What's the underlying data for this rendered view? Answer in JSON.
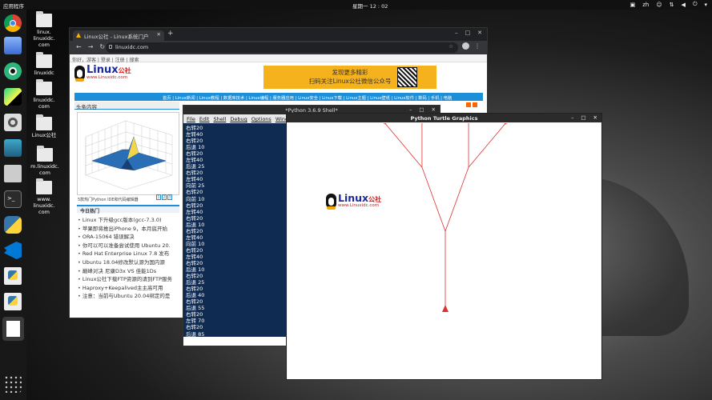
{
  "topbar": {
    "apps": "应用程序",
    "clock": "星期一 12 : 02",
    "lang": "zh"
  },
  "desktop_icons": [
    {
      "label": "linux.\nlinuxidc.\ncom"
    },
    {
      "label": "linuxidc"
    },
    {
      "label": "linuxidc.\ncom"
    },
    {
      "label": "Linux公社"
    },
    {
      "label": "m.linuxidc.\ncom"
    },
    {
      "label": "www.\nlinuxidc.\ncom"
    }
  ],
  "chrome": {
    "tab_title": "Linux公社 - Linux系统门户",
    "url": "linuxidc.com",
    "linkbar": "你好，游客  |  登录  |  注册  |  搜索",
    "logo": "Linux",
    "logo_cn": "公社",
    "logo_sub": "www.Linuxidc.com",
    "banner_line1": "发现更多精彩",
    "banner_line2": "扫码关注Linux公社微信公众号",
    "nav": "首页 | Linux新闻 | Linux教程 | 数据库技术 | Linux编程 | 服务器应用 | Linux安全 | Linux下载 | Linux主题 | Linux壁纸 | Linux软件 | 数码 | 手机 | 电脑",
    "section_title": "头条内容",
    "plot_caption": "5款热门Python IDE和代码编辑器",
    "pager": [
      "1",
      "2",
      "3"
    ],
    "hot_title": "今日热门",
    "hot_items": [
      "Linux 下升级gcc版本(gcc-7.3.0)",
      "苹果即将推出iPhone 9，本月底开始",
      "ORA-15064 错误解决",
      "你可以可以准备尝试使用 Ubuntu 20.",
      "Red Hat Enterprise Linux 7.8 发布",
      "Ubuntu 18.04修改默认源为国内源",
      "巅峰对决 尼康D3x VS 佳能1Ds",
      "Linux公社下载FTP资源的请到FTP服务",
      "Haproxy+Keepalived主主高可用",
      "注意：当前与Ubuntu 20.04绑定的是"
    ]
  },
  "shell": {
    "title": "*Python 3.6.9 Shell*",
    "menu": [
      "File",
      "Edit",
      "Shell",
      "Debug",
      "Options",
      "Wind"
    ],
    "lines": [
      "右转20",
      "左转40",
      "右转20",
      "后退 10",
      "右转20",
      "左转40",
      "后退 25",
      "右转20",
      "左转40",
      "向前 25",
      "右转20",
      "向前 10",
      "右转20",
      "左转40",
      "右转20",
      "后退 10",
      "右转20",
      "左转40",
      "向前 10",
      "右转20",
      "左转40",
      "右转20",
      "后退 10",
      "右转20",
      "后退 25",
      "右转20",
      "后退 40",
      "右转20",
      "后退 55",
      "右转20",
      "左转 70",
      "右转20",
      "后退 85",
      "右转20",
      "后退 100"
    ]
  },
  "turtle": {
    "title": "Python Turtle Graphics",
    "logo": "Linux",
    "logo_cn": "公社",
    "logo_sub": "www.Linuxidc.com"
  }
}
